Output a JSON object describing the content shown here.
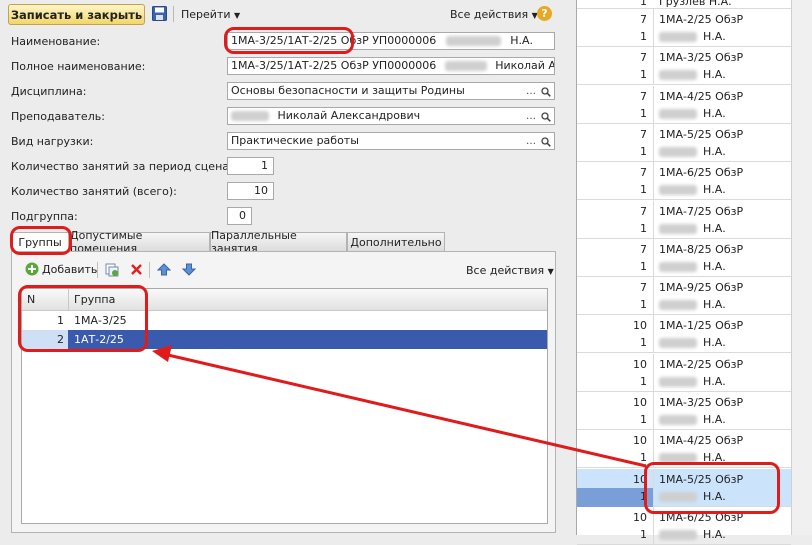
{
  "toolbar": {
    "save_close": "Записать и закрыть",
    "go": "Перейти",
    "all_actions": "Все действия",
    "help": "?"
  },
  "form": {
    "name_label": "Наименование:",
    "name_value": "1МА-3/25/1АТ-2/25 ОбзР УП0000006",
    "name_suffix": "Н.А.",
    "full_name_label": "Полное наименование:",
    "full_name_value": "1МА-3/25/1АТ-2/25 ОбзР УП0000006",
    "full_name_suffix": "Николай Алексан",
    "discipline_label": "Дисциплина:",
    "discipline_value": "Основы безопасности и защиты Родины",
    "teacher_label": "Преподаватель:",
    "teacher_value": "Николай Александрович",
    "load_label": "Вид нагрузки:",
    "load_value": "Практические работы",
    "count_period_label": "Количество занятий за период сценария:",
    "count_period_value": "1",
    "count_total_label": "Количество занятий (всего):",
    "count_total_value": "10",
    "subgroup_label": "Подгруппа:",
    "subgroup_value": "0"
  },
  "tabs": [
    "Группы",
    "Допустимые помещения",
    "Параллельные занятия",
    "Дополнительно"
  ],
  "groups_panel": {
    "add": "Добавить",
    "all_actions": "Все действия",
    "col_n": "N",
    "col_group": "Группа",
    "rows": [
      {
        "n": "1",
        "group": "1МА-3/25"
      },
      {
        "n": "2",
        "group": "1АТ-2/25"
      }
    ]
  },
  "right_list": {
    "top_partial": "Грузлев Н.А.",
    "top_partial_n": "1",
    "rows": [
      {
        "n1": "7",
        "n2": "1",
        "name": "1МА-2/25 ОбзР",
        "sub": "Н.А."
      },
      {
        "n1": "7",
        "n2": "1",
        "name": "1МА-3/25 ОбзР",
        "sub": "Н.А."
      },
      {
        "n1": "7",
        "n2": "1",
        "name": "1МА-4/25 ОбзР",
        "sub": "Н.А."
      },
      {
        "n1": "7",
        "n2": "1",
        "name": "1МА-5/25 ОбзР",
        "sub": "Н.А."
      },
      {
        "n1": "7",
        "n2": "1",
        "name": "1МА-6/25 ОбзР",
        "sub": "Н.А."
      },
      {
        "n1": "7",
        "n2": "1",
        "name": "1МА-7/25 ОбзР",
        "sub": "Н.А."
      },
      {
        "n1": "7",
        "n2": "1",
        "name": "1МА-8/25 ОбзР",
        "sub": "Н.А."
      },
      {
        "n1": "7",
        "n2": "1",
        "name": "1МА-9/25 ОбзР",
        "sub": "Н.А."
      },
      {
        "n1": "10",
        "n2": "1",
        "name": "1МА-1/25 ОбзР",
        "sub": "Н.А."
      },
      {
        "n1": "10",
        "n2": "1",
        "name": "1МА-2/25 ОбзР",
        "sub": "Н.А."
      },
      {
        "n1": "10",
        "n2": "1",
        "name": "1МА-3/25 ОбзР",
        "sub": "Н.А."
      },
      {
        "n1": "10",
        "n2": "1",
        "name": "1МА-4/25 ОбзР",
        "sub": "Н.А."
      },
      {
        "n1": "10",
        "n2": "1",
        "name": "1МА-5/25 ОбзР",
        "sub": "Н.А."
      },
      {
        "n1": "10",
        "n2": "1",
        "name": "1МА-6/25 ОбзР",
        "sub": "Н.А."
      }
    ]
  },
  "colors": {
    "accent": "#3a5aae",
    "annotation": "#e01b1b",
    "selected_right": "#cce4fb"
  }
}
